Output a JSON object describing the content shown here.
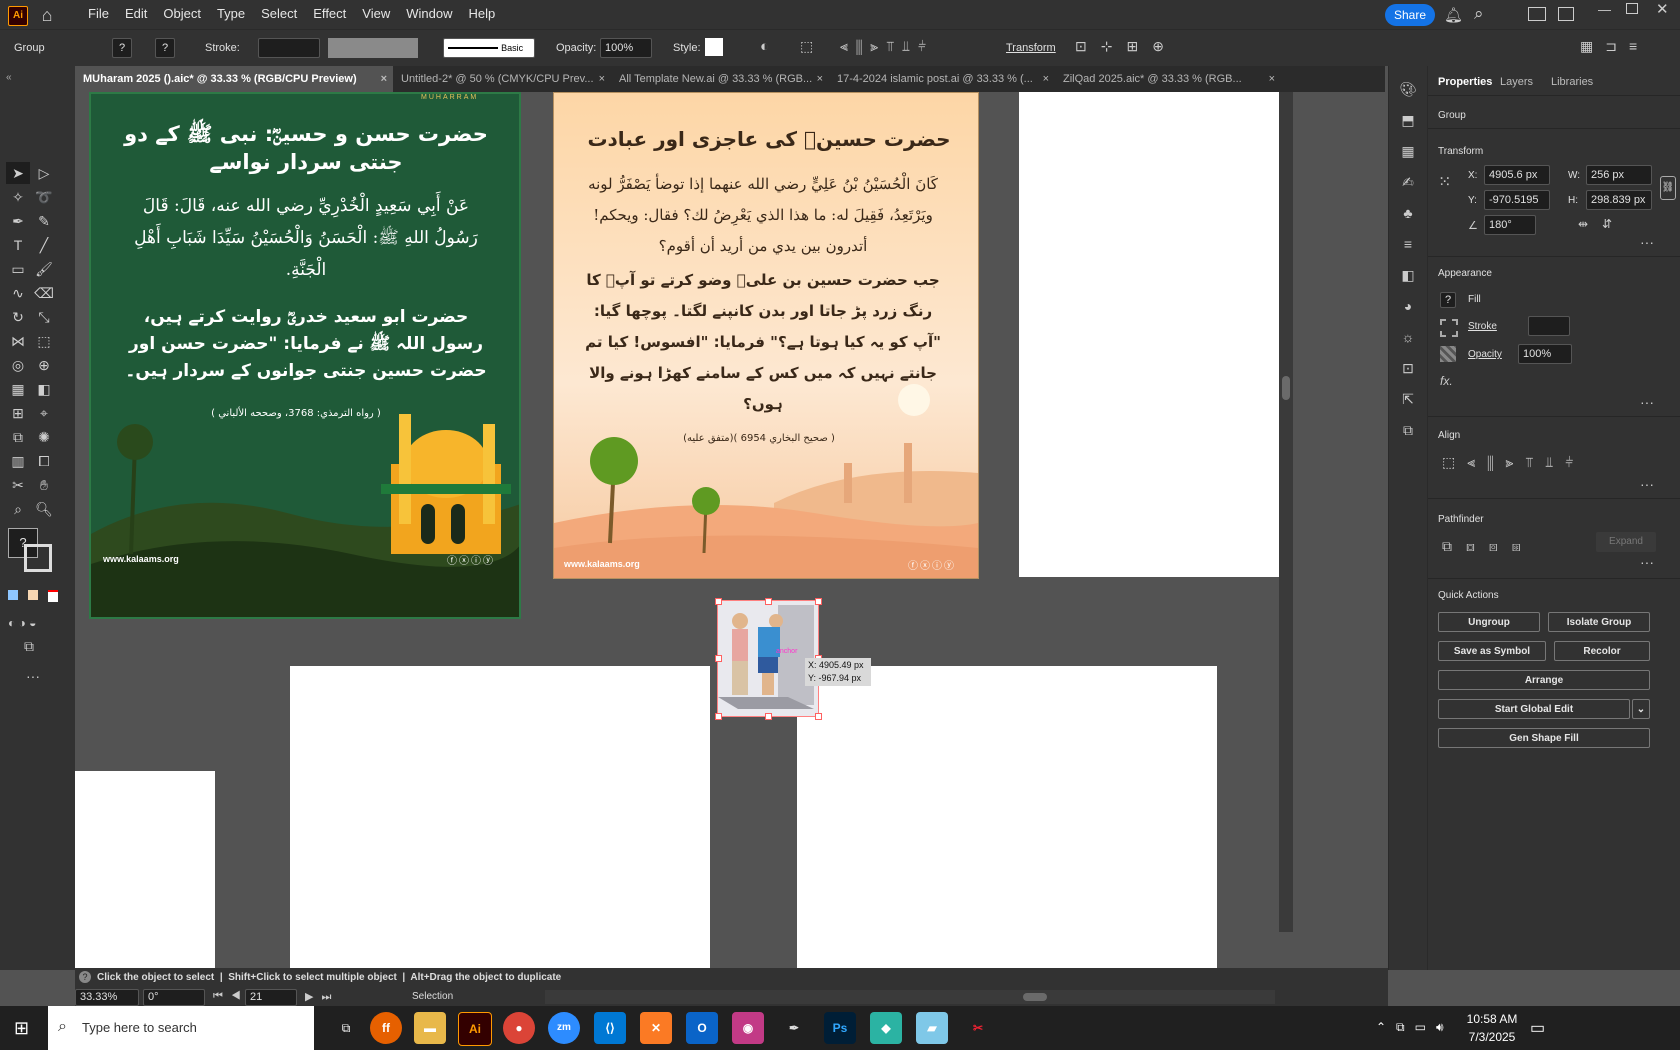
{
  "app": {
    "logo": "Ai",
    "menu": [
      "File",
      "Edit",
      "Object",
      "Type",
      "Select",
      "Effect",
      "View",
      "Window",
      "Help"
    ],
    "share": "Share"
  },
  "control": {
    "group": "Group",
    "stroke_label": "Stroke:",
    "stroke_style": "Basic",
    "opacity_label": "Opacity:",
    "opacity": "100%",
    "style_label": "Style:",
    "transform": "Transform"
  },
  "tabs": [
    {
      "label": "MUharam 2025 ().aic* @ 33.33 % (RGB/CPU Preview)",
      "active": true
    },
    {
      "label": "Untitled-2* @ 50 % (CMYK/CPU Prev...",
      "active": false
    },
    {
      "label": "All Template New.ai @ 33.33 % (RGB...",
      "active": false
    },
    {
      "label": "17-4-2024 islamic post.ai @ 33.33 % (...",
      "active": false
    },
    {
      "label": "ZilQad 2025.aic* @ 33.33 % (RGB...",
      "active": false
    }
  ],
  "panel": {
    "tabs": [
      "Properties",
      "Layers",
      "Libraries"
    ],
    "group": "Group",
    "transform": "Transform",
    "x_label": "X:",
    "x": "4905.6 px",
    "y_label": "Y:",
    "y": "-970.5195 p",
    "w_label": "W:",
    "w": "256 px",
    "h_label": "H:",
    "h": "298.839 px",
    "angle": "180°",
    "appearance": "Appearance",
    "fill": "Fill",
    "stroke": "Stroke",
    "opacity": "Opacity",
    "opacity_value": "100%",
    "fx": "fx.",
    "align": "Align",
    "pathfinder": "Pathfinder",
    "expand": "Expand",
    "quick_actions": "Quick Actions",
    "qa": [
      "Ungroup",
      "Isolate Group",
      "Save as Symbol",
      "Recolor",
      "Arrange",
      "Start Global Edit",
      "Gen Shape Fill"
    ]
  },
  "art1": {
    "brand": "MUHARRAM",
    "title": "حضرت حسن و حسینؓ: نبی ﷺ کے دو جنتی سردار نواسے",
    "arabic": "عَنْ أَبِي سَعِيدٍ الْخُدْرِيِّ رضي الله عنه، قَالَ: قَالَ رَسُولُ اللهِ ﷺ: الْحَسَنُ وَالْحُسَيْنُ سَيِّدَا شَبَابِ أَهْلِ الْجَنَّةِ.",
    "urdu": "حضرت ابو سعید خدریؓ روایت کرتے ہیں، رسول اللہ ﷺ نے فرمایا: \"حضرت حسن اور حضرت حسین جنتی جوانوں کے سردار ہیں۔",
    "ref": "( رواه الترمذي: 3768، وصححه الألباني )",
    "site": "www.kalaams.org"
  },
  "art2": {
    "title": "حضرت حسینؓ کی عاجزی اور عبادت",
    "arabic": "كَانَ الْحُسَيْنُ بْنُ عَلِيٍّ رضي الله عنهما إذا توضأ يَصْفَرُّ لونه ويَرْتَعِدُ، فَقِيلَ له: ما هذا الذي يَعْرِضُ لك؟ فقال: ويحكم! أتدرون بين يدي من أريد أن أقوم؟",
    "urdu": "جب حضرت حسین بن علیؓ وضو کرتے تو آپؓ کا رنگ زرد پڑ جاتا اور بدن کانپنے لگتا۔ پوچھا گیا: \"آپ کو یہ کیا ہوتا ہے؟\" فرمایا: \"افسوس! کیا تم جانتے نہیں کہ میں کس کے سامنے کھڑا ہونے والا ہوں؟",
    "ref": "( صحيح البخاري 6954 )(متفق عليه)",
    "site": "www.kalaams.org"
  },
  "tooltip": {
    "x": "X: 4905.49 px",
    "y": "Y: -967.94 px",
    "anchor": "anchor"
  },
  "hint": {
    "a": "Click the object to select",
    "b": "Shift+Click to select multiple object",
    "c": "Alt+Drag the object to duplicate"
  },
  "status": {
    "zoom": "33.33%",
    "rotate": "0°",
    "artboard": "21",
    "mode": "Selection"
  },
  "taskbar": {
    "search": "Type here to search",
    "time": "10:58 AM",
    "date": "7/3/2025"
  }
}
